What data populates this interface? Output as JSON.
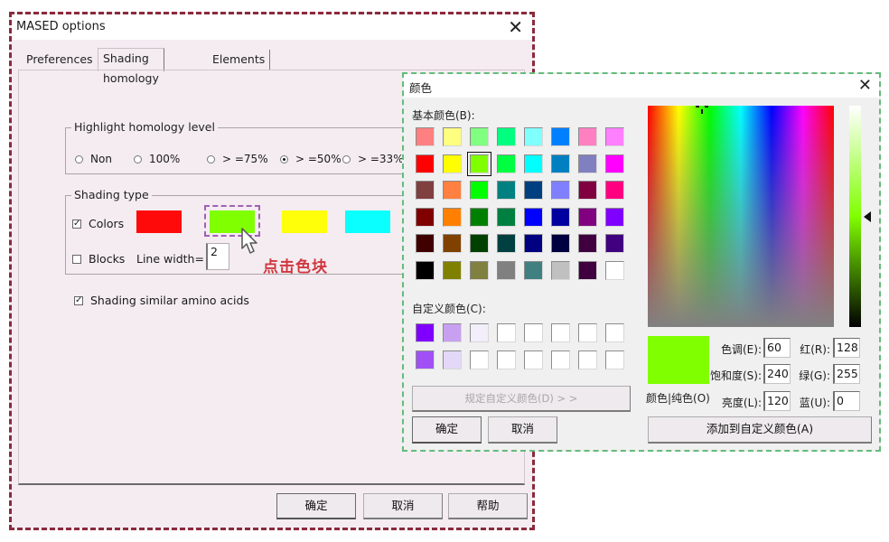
{
  "main_dialog": {
    "title": "MASED options",
    "close_label": "✕",
    "tabs": [
      {
        "label": "Preferences",
        "active": false
      },
      {
        "label": "Shading homology",
        "active": true
      },
      {
        "label": "Elements",
        "active": false
      }
    ],
    "highlight_group": {
      "legend": "Highlight homology level",
      "options": [
        {
          "label": "Non",
          "checked": false
        },
        {
          "label": "100%",
          "checked": false
        },
        {
          "label": "> =75%",
          "checked": false
        },
        {
          "label": "> =50%",
          "checked": true
        },
        {
          "label": "> =33%",
          "checked": false
        }
      ]
    },
    "shading_group": {
      "legend": "Shading type",
      "colors_label": "Colors",
      "colors_checked": true,
      "blocks_label": "Blocks",
      "blocks_checked": false,
      "line_width_label": "Line width=",
      "line_width_value": "2",
      "swatches": [
        {
          "name": "red",
          "color": "#ff0a0a"
        },
        {
          "name": "green",
          "color": "#80ff00"
        },
        {
          "name": "yellow",
          "color": "#ffff0a"
        },
        {
          "name": "cyan",
          "color": "#0affff"
        }
      ]
    },
    "similar_label": "Shading similar amino acids",
    "similar_checked": true,
    "annotation": "点击色块",
    "buttons": {
      "ok": "确定",
      "cancel": "取消",
      "help": "帮助"
    }
  },
  "color_dialog": {
    "title": "颜色",
    "close_label": "✕",
    "basic_label": "基本颜色(B):",
    "basic_colors": [
      [
        "#ff8080",
        "#ffff80",
        "#80ff80",
        "#00ff80",
        "#80ffff",
        "#0080ff",
        "#ff80c0",
        "#ff80ff"
      ],
      [
        "#ff0000",
        "#ffff00",
        "#80ff00",
        "#00ff40",
        "#00ffff",
        "#0080c0",
        "#8080c0",
        "#ff00ff"
      ],
      [
        "#804040",
        "#ff8040",
        "#00ff00",
        "#008080",
        "#004080",
        "#8080ff",
        "#800040",
        "#ff0080"
      ],
      [
        "#800000",
        "#ff8000",
        "#008000",
        "#008040",
        "#0000ff",
        "#0000a0",
        "#800080",
        "#8000ff"
      ],
      [
        "#400000",
        "#804000",
        "#004000",
        "#004040",
        "#000080",
        "#000040",
        "#400040",
        "#400080"
      ],
      [
        "#000000",
        "#808000",
        "#808040",
        "#808080",
        "#408080",
        "#c0c0c0",
        "#400040",
        "#ffffff"
      ]
    ],
    "selected_basic": [
      1,
      2
    ],
    "custom_label": "自定义颜色(C):",
    "custom_colors": [
      [
        "#8000ff",
        "#c8a0f0",
        "#f2eefa",
        "#ffffff",
        "#ffffff",
        "#ffffff",
        "#ffffff",
        "#ffffff"
      ],
      [
        "#a050f5",
        "#e4d8f8",
        "#ffffff",
        "#ffffff",
        "#ffffff",
        "#ffffff",
        "#ffffff",
        "#ffffff"
      ]
    ],
    "define_custom_label": "规定自定义颜色(D) > >",
    "ok_label": "确定",
    "cancel_label": "取消",
    "preview_color": "#80ff00",
    "preview_label": "颜色|纯色(O)",
    "fields": {
      "hue": {
        "label": "色调(E):",
        "value": "60"
      },
      "sat": {
        "label": "饱和度(S):",
        "value": "240"
      },
      "lum": {
        "label": "亮度(L):",
        "value": "120"
      },
      "red": {
        "label": "红(R):",
        "value": "128"
      },
      "green": {
        "label": "绿(G):",
        "value": "255"
      },
      "blue": {
        "label": "蓝(U):",
        "value": "0"
      }
    },
    "add_custom_label": "添加到自定义颜色(A)"
  }
}
